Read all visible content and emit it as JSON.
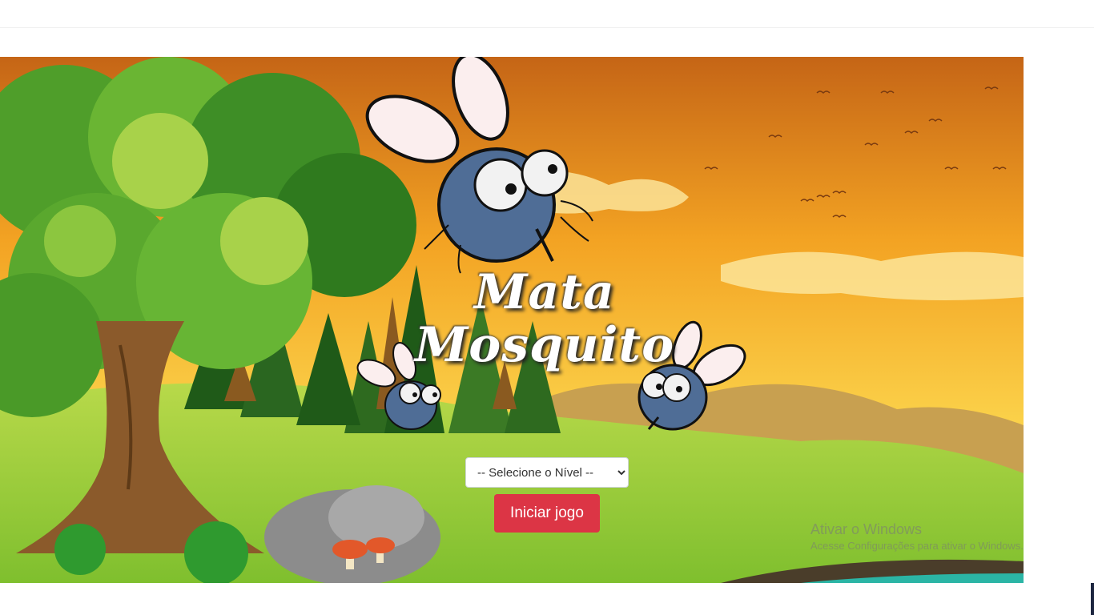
{
  "game": {
    "title_line1": "Mata",
    "title_line2": "Mosquito"
  },
  "level_select": {
    "selected": "-- Selecione o Nível --",
    "options": [
      "-- Selecione o Nível --"
    ]
  },
  "start_button": {
    "label": "Iniciar jogo"
  },
  "watermark": {
    "line1": "Ativar o Windows",
    "line2": "Acesse Configurações para ativar o Windows."
  },
  "colors": {
    "sky_top": "#c7661a",
    "sky_bottom": "#fbd24a",
    "grass": "#8cc63f",
    "button": "#dc3545",
    "mosquito_body": "#4f6d96"
  }
}
